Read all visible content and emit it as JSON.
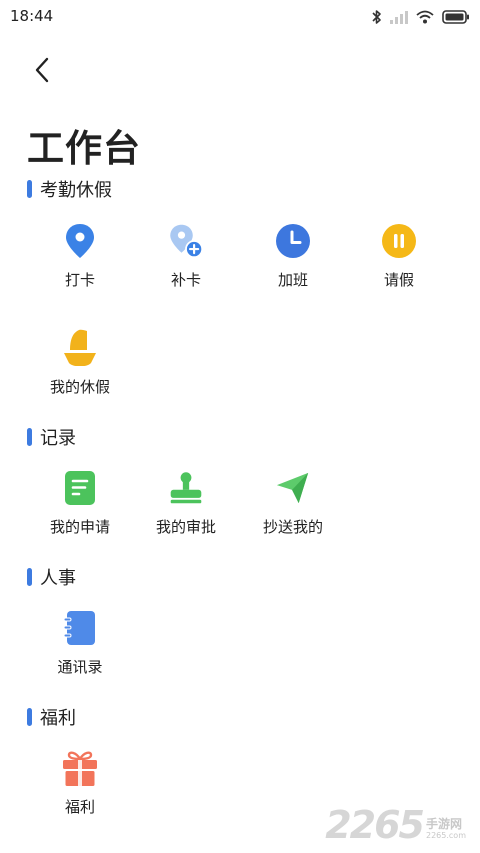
{
  "status_bar": {
    "time": "18:44",
    "icons": [
      "bluetooth-icon",
      "signal-icon",
      "wifi-icon",
      "battery-icon"
    ]
  },
  "header": {
    "back_icon": "chevron-left-icon",
    "title": "工作台"
  },
  "colors": {
    "accent": "#3d7be0",
    "location": "#3b82e6",
    "clock": "#3d77de",
    "leave": "#f5b817",
    "vacation": "#f2b21b",
    "green": "#4cc35c",
    "send": "#5dcb6b",
    "contacts": "#4f8ae8",
    "gift": "#f2745a"
  },
  "sections": {
    "attendance": {
      "title": "考勤休假",
      "items": [
        {
          "label": "打卡",
          "icon": "location-pin-icon"
        },
        {
          "label": "补卡",
          "icon": "location-add-icon"
        },
        {
          "label": "加班",
          "icon": "clock-icon"
        },
        {
          "label": "请假",
          "icon": "pause-icon"
        },
        {
          "label": "我的休假",
          "icon": "sailboat-icon"
        }
      ]
    },
    "records": {
      "title": "记录",
      "items": [
        {
          "label": "我的申请",
          "icon": "document-icon"
        },
        {
          "label": "我的审批",
          "icon": "stamp-icon"
        },
        {
          "label": "抄送我的",
          "icon": "send-icon"
        }
      ]
    },
    "hr": {
      "title": "人事",
      "items": [
        {
          "label": "通讯录",
          "icon": "contacts-book-icon"
        }
      ]
    },
    "welfare": {
      "title": "福利",
      "items": [
        {
          "label": "福利",
          "icon": "gift-icon"
        }
      ]
    }
  },
  "watermark": {
    "digits": "2265",
    "text": "手游网",
    "url": "2265.com"
  }
}
